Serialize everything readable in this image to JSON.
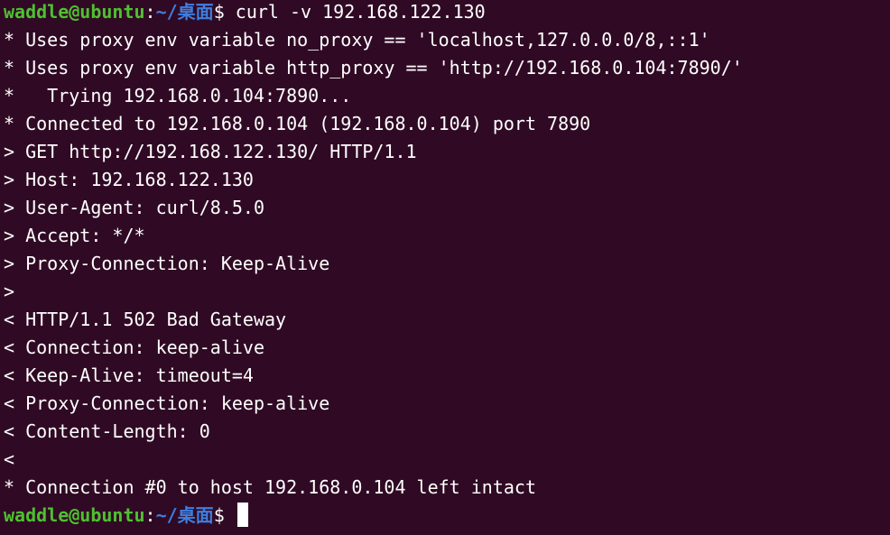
{
  "prompt": {
    "user_host": "waddle@ubuntu",
    "separator": ":",
    "path": "~/桌面",
    "symbol": "$ "
  },
  "command": "curl -v 192.168.122.130",
  "output_lines": [
    "* Uses proxy env variable no_proxy == 'localhost,127.0.0.0/8,::1'",
    "* Uses proxy env variable http_proxy == 'http://192.168.0.104:7890/'",
    "*   Trying 192.168.0.104:7890...",
    "* Connected to 192.168.0.104 (192.168.0.104) port 7890",
    "> GET http://192.168.122.130/ HTTP/1.1",
    "> Host: 192.168.122.130",
    "> User-Agent: curl/8.5.0",
    "> Accept: */*",
    "> Proxy-Connection: Keep-Alive",
    ">",
    "< HTTP/1.1 502 Bad Gateway",
    "< Connection: keep-alive",
    "< Keep-Alive: timeout=4",
    "< Proxy-Connection: keep-alive",
    "< Content-Length: 0",
    "<",
    "* Connection #0 to host 192.168.0.104 left intact"
  ],
  "colors": {
    "background": "#300a24",
    "text": "#ffffff",
    "user_host": "#4ec130",
    "path": "#3e7fe0"
  }
}
